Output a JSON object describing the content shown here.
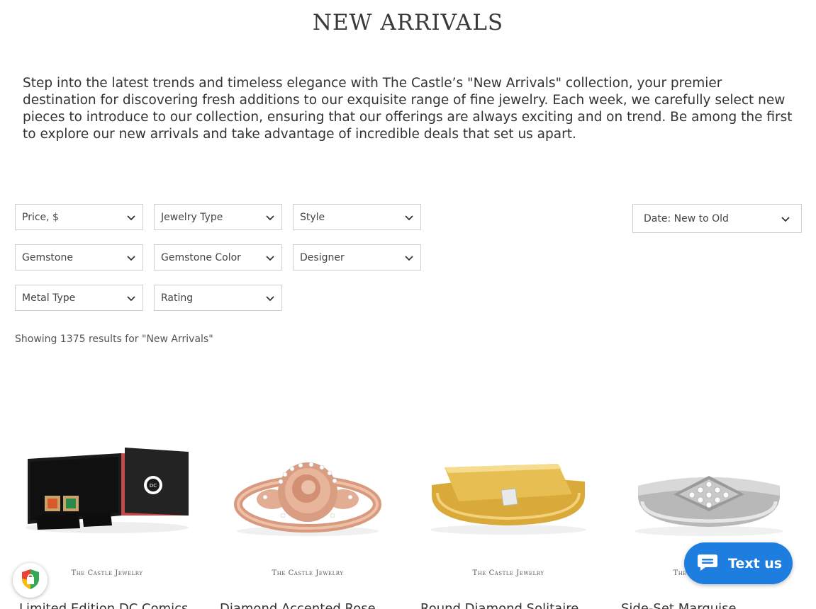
{
  "header": {
    "title": "NEW ARRIVALS"
  },
  "intro": {
    "text": "Step into the latest trends and timeless elegance with The Castle’s \"New Arrivals\" collection, your premier destination for discovering fresh additions to our exquisite range of fine jewelry. Each week, we carefully select new pieces to introduce to our collection, ensuring that our offerings are always exciting and on trend. Be among the first to explore our new arrivals and take advantage of incredible deals that set us apart."
  },
  "filters": {
    "price": "Price, $",
    "jewelry_type": "Jewelry Type",
    "style": "Style",
    "gemstone": "Gemstone",
    "gemstone_color": "Gemstone Color",
    "designer": "Designer",
    "metal_type": "Metal Type",
    "rating": "Rating",
    "icon": "chevron-down-icon"
  },
  "sort": {
    "selected": "Date: New to Old"
  },
  "results": {
    "text": "Showing 1375 results for \"New Arrivals\""
  },
  "products": [
    {
      "brand": "The Castle Jewelry",
      "name": "Limited Edition DC Comics"
    },
    {
      "brand": "The Castle Jewelry",
      "name": "Diamond Accented Rose"
    },
    {
      "brand": "The Castle Jewelry",
      "name": "Round Diamond Solitaire"
    },
    {
      "brand": "The Castle Jewelry",
      "name": "Side-Set Marquise"
    }
  ],
  "chat": {
    "label": "Text us",
    "icon": "chat-bubble-icon",
    "color": "#1d7ee0"
  },
  "badge": {
    "icon": "shield-badge-icon"
  }
}
